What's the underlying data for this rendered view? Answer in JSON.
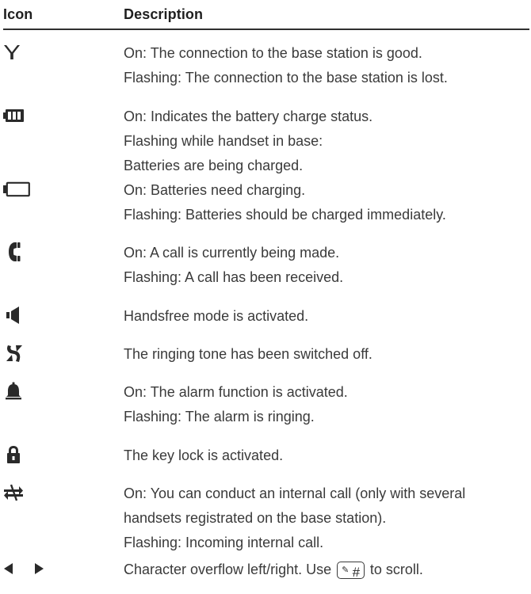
{
  "header": {
    "icon_label": "Icon",
    "description_label": "Description"
  },
  "rows": [
    {
      "icon": "antenna-icon",
      "lines": [
        "On: The connection to the base station is good.",
        "Flashing: The connection to the base station is lost."
      ]
    },
    {
      "icon": "battery-full-icon",
      "lines": [
        "On: Indicates the battery charge status.",
        "Flashing while handset in base:",
        "Batteries are being charged."
      ]
    },
    {
      "icon": "battery-empty-icon",
      "lines": [
        "On: Batteries need charging.",
        "Flashing: Batteries should be charged immediately."
      ]
    },
    {
      "icon": "handset-icon",
      "lines": [
        "On: A call is currently being made.",
        "Flashing: A call has been received."
      ]
    },
    {
      "icon": "speaker-icon",
      "lines": [
        "Handsfree mode is activated."
      ]
    },
    {
      "icon": "ringer-off-icon",
      "lines": [
        "The ringing tone has been switched off."
      ]
    },
    {
      "icon": "bell-icon",
      "lines": [
        "On: The alarm function is activated.",
        "Flashing: The alarm is ringing."
      ]
    },
    {
      "icon": "lock-icon",
      "lines": [
        "The key lock is activated."
      ]
    },
    {
      "icon": "internal-call-icon",
      "lines": [
        "On: You can conduct an internal call (only with several",
        "handsets registrated on the base station).",
        "Flashing: Incoming internal call."
      ]
    },
    {
      "icon": "arrow-left-right-icon",
      "lines": [
        "Character overflow left/right. Use",
        "to scroll."
      ],
      "key_label": "#"
    }
  ]
}
